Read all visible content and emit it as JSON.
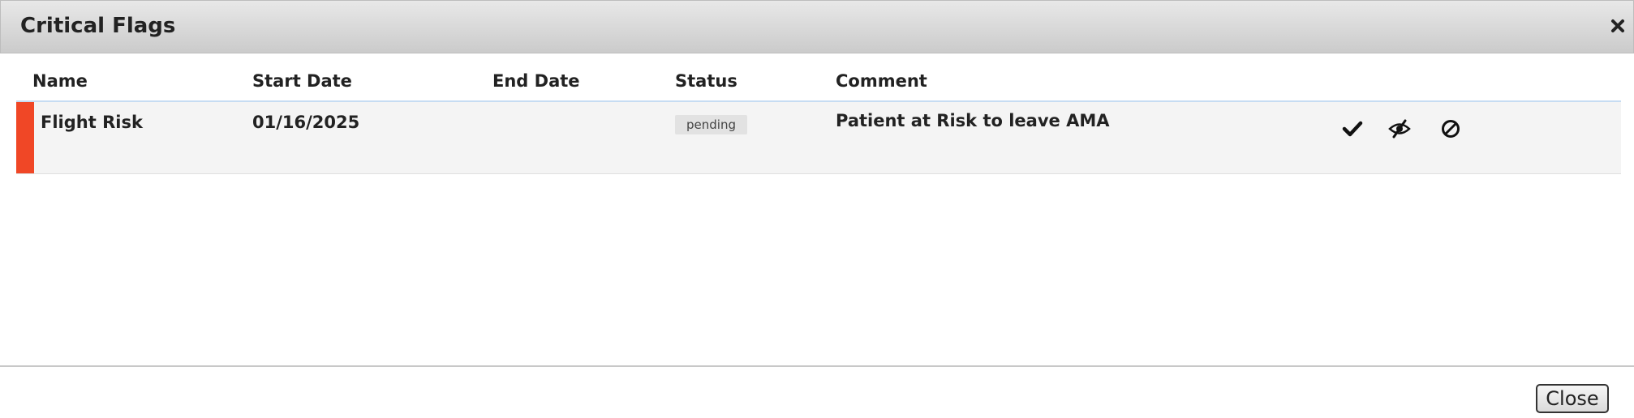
{
  "dialog": {
    "title": "Critical Flags",
    "close_icon": "close-x-icon"
  },
  "table": {
    "headers": [
      "Name",
      "Start Date",
      "End Date",
      "Status",
      "Comment"
    ],
    "rows": [
      {
        "severity_color": "#f04726",
        "name": "Flight Risk",
        "start_date": "01/16/2025",
        "end_date": "",
        "status": "pending",
        "comment": "Patient at Risk to leave AMA",
        "actions": [
          "checkmark-icon",
          "eye-slash-icon",
          "prohibit-icon"
        ]
      }
    ]
  },
  "footer": {
    "close_label": "Close"
  },
  "colors": {
    "severity": "#f04726",
    "header_rule": "#c6dcf2",
    "row_background": "#f4f4f4",
    "badge_background": "#e2e2e2"
  }
}
